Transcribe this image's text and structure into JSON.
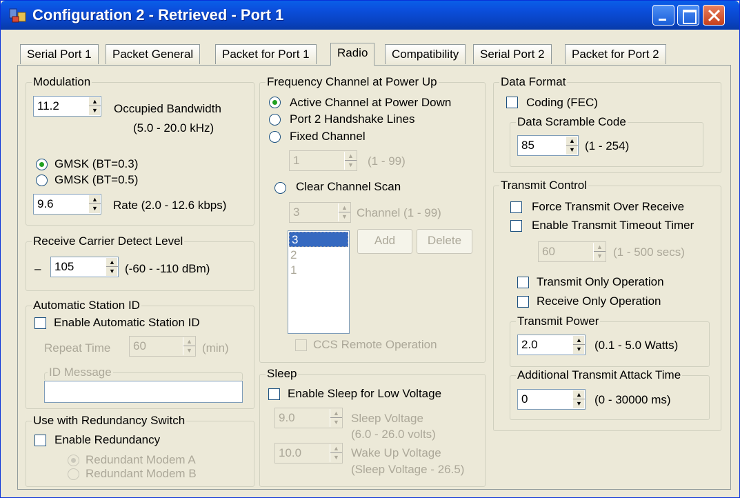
{
  "window": {
    "title": "Configuration 2 - Retrieved - Port 1"
  },
  "tabs": [
    "Serial Port 1",
    "Packet General",
    "Packet for Port 1",
    "Radio",
    "Compatibility",
    "Serial Port 2",
    "Packet for Port 2"
  ],
  "active_tab": "Radio",
  "modulation": {
    "title": "Modulation",
    "bandwidth_value": "11.2",
    "bandwidth_label": "Occupied Bandwidth",
    "bandwidth_range": "(5.0 - 20.0 kHz)",
    "gmsk1": "GMSK (BT=0.3)",
    "gmsk2": "GMSK (BT=0.5)",
    "selected": "GMSK (BT=0.3)",
    "rate_value": "9.6",
    "rate_label": "Rate  (2.0 - 12.6 kbps)"
  },
  "carrier": {
    "title": "Receive Carrier Detect Level",
    "sign": "–",
    "value": "105",
    "range": "(-60 - -110 dBm)"
  },
  "station_id": {
    "title": "Automatic Station ID",
    "enable_label": "Enable Automatic Station ID",
    "enabled": false,
    "repeat_label": "Repeat Time",
    "repeat_value": "60",
    "repeat_unit": "(min)",
    "message_label": "ID Message",
    "message_value": ""
  },
  "redundancy": {
    "title": "Use with Redundancy Switch",
    "enable_label": "Enable Redundancy",
    "enabled": false,
    "modem_a": "Redundant Modem A",
    "modem_b": "Redundant Modem B",
    "selected": "Redundant Modem A"
  },
  "frequency": {
    "title": "Frequency Channel at Power Up",
    "opt_active": "Active Channel at Power Down",
    "opt_handshake": "Port 2 Handshake Lines",
    "opt_fixed": "Fixed Channel",
    "selected": "Active Channel at Power Down",
    "fixed_value": "1",
    "fixed_range": "(1 - 99)",
    "opt_scan": "Clear Channel Scan",
    "scan_value": "3",
    "scan_label": "Channel  (1 - 99)",
    "add_button": "Add",
    "delete_button": "Delete",
    "channel_list": [
      "3",
      "2",
      "1"
    ],
    "ccs_label": "CCS Remote Operation"
  },
  "sleep": {
    "title": "Sleep",
    "enable_label": "Enable Sleep for Low Voltage",
    "enabled": false,
    "sleep_value": "9.0",
    "sleep_label1": "Sleep Voltage",
    "sleep_label2": "(6.0 - 26.0 volts)",
    "wake_value": "10.0",
    "wake_label1": "Wake Up Voltage",
    "wake_label2": "(Sleep Voltage  - 26.5)"
  },
  "data_format": {
    "title": "Data Format",
    "coding_label": "Coding (FEC)",
    "coding": false,
    "scramble_title": "Data Scramble Code",
    "scramble_value": "85",
    "scramble_range": "(1 - 254)"
  },
  "transmit": {
    "title": "Transmit Control",
    "force_label": "Force Transmit Over Receive",
    "timeout_label": "Enable Transmit Timeout Timer",
    "timeout_value": "60",
    "timeout_range": "(1 - 500 secs)",
    "tx_only_label": "Transmit Only Operation",
    "rx_only_label": "Receive Only Operation",
    "power_title": "Transmit Power",
    "power_value": "2.0",
    "power_range": "(0.1 - 5.0 Watts)",
    "attack_title": "Additional Transmit Attack Time",
    "attack_value": "0",
    "attack_range": "(0 - 30000 ms)"
  },
  "colors": {
    "titlebar": "#0a5fe8",
    "face": "#ece9d8",
    "selection": "#3569c0",
    "radio_dot": "#21a121"
  }
}
